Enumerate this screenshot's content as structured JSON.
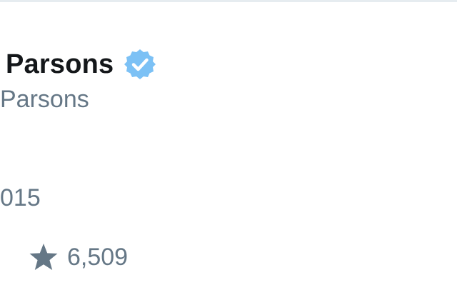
{
  "profile": {
    "display_name": "Parsons",
    "handle": "Parsons",
    "verified_icon": "verified-badge-icon",
    "verified_color": "#7cc1f5"
  },
  "tweet": {
    "date": "015",
    "favorites": {
      "icon": "star-icon",
      "count": "6,509"
    }
  },
  "colors": {
    "text_primary": "#14171a",
    "text_secondary": "#657786",
    "divider": "#e6ecf0"
  }
}
